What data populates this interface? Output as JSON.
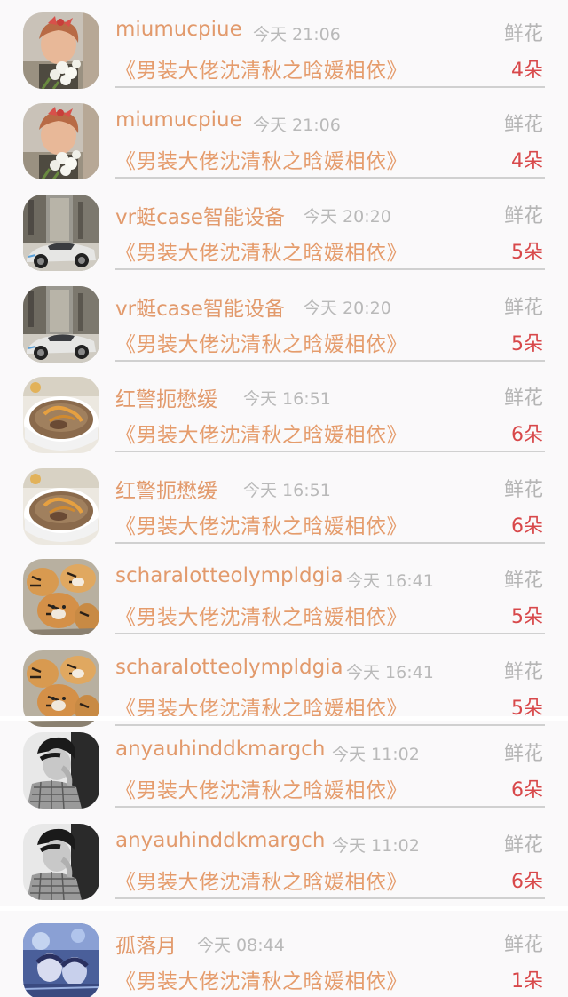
{
  "records": [
    {
      "user": "miumucpiue",
      "time": "今天 21:06",
      "gift_type": "鲜花",
      "book": "《男装大佬沈清秋之晗媛相依》",
      "count": "4朵",
      "avatar": "girl-flowers-avatar"
    },
    {
      "user": "miumucpiue",
      "time": "今天 21:06",
      "gift_type": "鲜花",
      "book": "《男装大佬沈清秋之晗媛相依》",
      "count": "4朵",
      "avatar": "girl-flowers-avatar"
    },
    {
      "user": "vr蜓case智能设备",
      "time": "今天 20:20",
      "gift_type": "鲜花",
      "book": "《男装大佬沈清秋之晗媛相依》",
      "count": "5朵",
      "avatar": "car-avatar"
    },
    {
      "user": "vr蜓case智能设备",
      "time": "今天 20:20",
      "gift_type": "鲜花",
      "book": "《男装大佬沈清秋之晗媛相依》",
      "count": "5朵",
      "avatar": "car-avatar"
    },
    {
      "user": "红警扼懋缓",
      "time": "今天 16:51",
      "gift_type": "鲜花",
      "book": "《男装大佬沈清秋之晗媛相依》",
      "count": "6朵",
      "avatar": "soup-bowl-avatar"
    },
    {
      "user": "红警扼懋缓",
      "time": "今天 16:51",
      "gift_type": "鲜花",
      "book": "《男装大佬沈清秋之晗媛相依》",
      "count": "6朵",
      "avatar": "soup-bowl-avatar"
    },
    {
      "user": "scharalotteolympldgia",
      "time": "今天 16:41",
      "gift_type": "鲜花",
      "book": "《男装大佬沈清秋之晗媛相依》",
      "count": "5朵",
      "avatar": "tigers-avatar"
    },
    {
      "user": "scharalotteolympldgia",
      "time": "今天 16:41",
      "gift_type": "鲜花",
      "book": "《男装大佬沈清秋之晗媛相依》",
      "count": "5朵",
      "avatar": "tigers-avatar"
    },
    {
      "user": "anyauhinddkmargch",
      "time": "今天 11:02",
      "gift_type": "鲜花",
      "book": "《男装大佬沈清秋之晗媛相依》",
      "count": "6朵",
      "avatar": "bw-portrait-avatar"
    },
    {
      "user": "anyauhinddkmargch",
      "time": "今天 11:02",
      "gift_type": "鲜花",
      "book": "《男装大佬沈清秋之晗媛相依》",
      "count": "6朵",
      "avatar": "bw-portrait-avatar"
    },
    {
      "user": "孤落月",
      "time": "今天 08:44",
      "gift_type": "鲜花",
      "book": "《男装大佬沈清秋之晗媛相依》",
      "count": "1朵",
      "avatar": "blue-anime-avatar"
    }
  ],
  "colors": {
    "username": "#e29a6c",
    "book_title": "#e59c6c",
    "time": "#b9b9b9",
    "gift_type": "#b5b5b5",
    "gift_count": "#d8484a",
    "background": "#faf9fa"
  }
}
